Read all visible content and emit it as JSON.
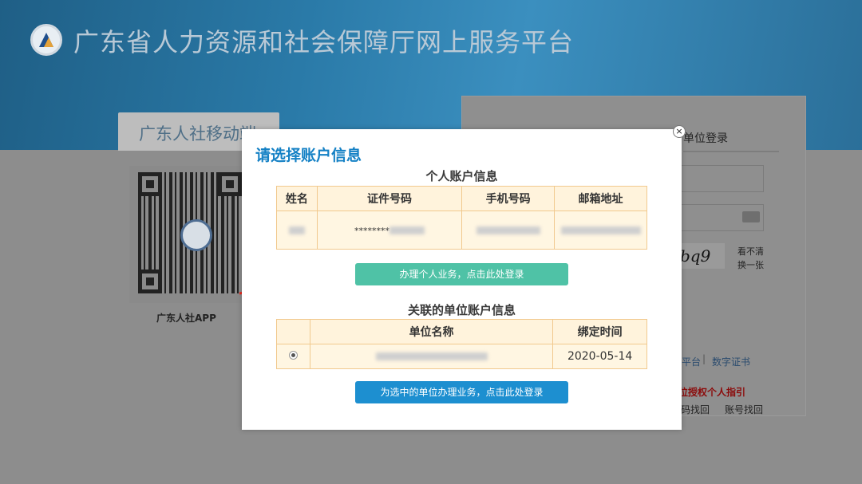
{
  "site": {
    "title": "广东省人力资源和社会保障厅网上服务平台"
  },
  "mobile": {
    "tab_label": "广东人社移动端",
    "app_label": "广东人社APP"
  },
  "login": {
    "tab_label": "单位登录",
    "captcha_text": "bq9",
    "captcha_hint_line1": "看不清",
    "captcha_hint_line2": "换一张",
    "link_platform": "平台",
    "link_separator": "|",
    "link_cert": "数字证书",
    "auth_link": "位授权个人指引",
    "recover_password": "码找回",
    "recover_account": "账号找回"
  },
  "modal": {
    "close_glyph": "×",
    "title": "请选择账户信息",
    "personal": {
      "section_title": "个人账户信息",
      "headers": [
        "姓名",
        "证件号码",
        "手机号码",
        "邮箱地址"
      ],
      "id_masked": "********"
    },
    "personal_button": "办理个人业务，点击此处登录",
    "unit": {
      "section_title": "关联的单位账户信息",
      "headers": [
        "",
        "单位名称",
        "绑定时间"
      ],
      "rows": [
        {
          "bind_time": "2020-05-14",
          "selected": true
        }
      ]
    },
    "unit_button": "为选中的单位办理业务，点击此处登录"
  },
  "colors": {
    "accent": "#1581c5",
    "green_button": "#4fc2a6",
    "blue_button": "#1d8fd0",
    "table_border": "#f1c98e",
    "arrow": "#e8281e"
  }
}
